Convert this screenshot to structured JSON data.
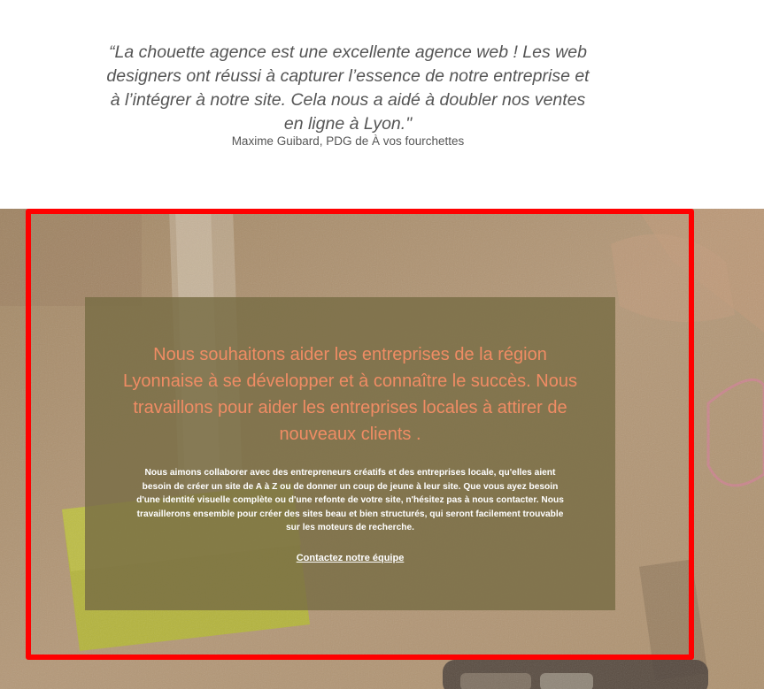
{
  "testimonial": {
    "quote": "“La chouette agence est une excellente agence web ! Les web designers ont réussi à capturer l’essence de notre entreprise et à l’intégrer à notre site. Cela nous a aidé à doubler nos ventes en ligne à Lyon.\"",
    "author": "Maxime Guibard, PDG de À vos fourchettes"
  },
  "hero": {
    "headline": "Nous souhaitons aider les entreprises de la région Lyonnaise à se développer et à connaître le succès. Nous travaillons pour aider les entreprises locales à attirer de nouveaux clients .",
    "body": "Nous aimons collaborer avec des entrepreneurs créatifs et des entreprises locale, qu'elles aient besoin de créer un site de A à Z ou de donner un coup de jeune à leur site. Que vous ayez besoin d'une identité visuelle complète ou d'une refonte de votre site, n'hésitez pas à nous contacter. Nous travaillerons ensemble pour créer des sites beau et bien structurés, qui seront facilement trouvable sur les moteurs de recherche.",
    "cta_label": "Contactez notre équipe"
  },
  "colors": {
    "headline": "#f08c64",
    "highlight_border": "#ff0000",
    "panel_overlay": "#786c44",
    "quote_text": "#555555"
  }
}
